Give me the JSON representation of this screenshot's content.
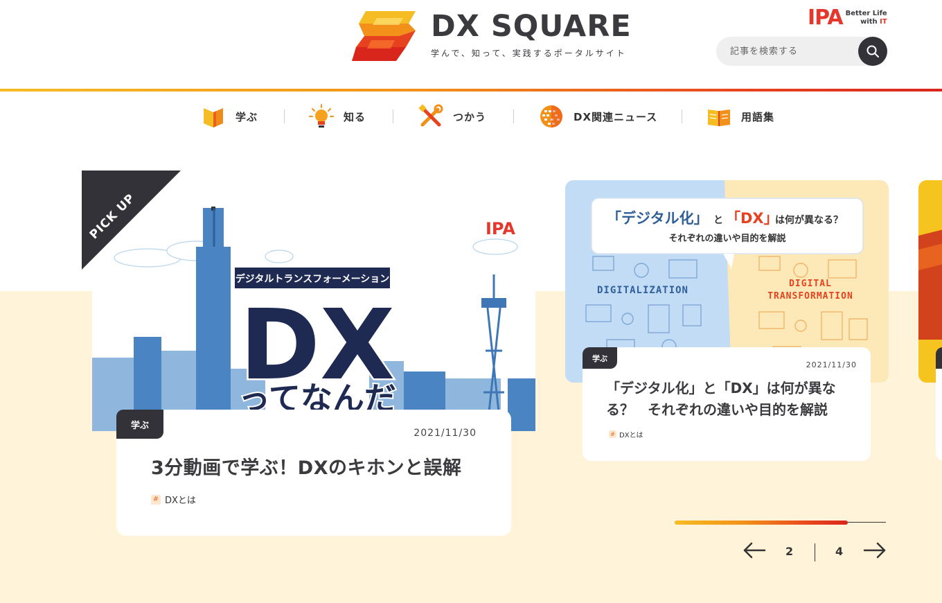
{
  "header": {
    "logo_title": "DX SQUARE",
    "logo_tagline": "学んで、知って、実践するポータルサイト",
    "ipa_letters": "IPA",
    "ipa_slogan_line1": "Better Life",
    "ipa_slogan_with": "with",
    "ipa_slogan_it": "IT",
    "search_placeholder": "記事を検索する"
  },
  "nav": [
    {
      "label": "学ぶ",
      "icon": "book-icon"
    },
    {
      "label": "知る",
      "icon": "lightbulb-icon"
    },
    {
      "label": "つかう",
      "icon": "tools-icon"
    },
    {
      "label": "DX関連ニュース",
      "icon": "globe-icon"
    },
    {
      "label": "用語集",
      "icon": "open-book-icon"
    }
  ],
  "pickup_label": "PICK UP",
  "featured": {
    "category": "学ぶ",
    "date": "2021/11/30",
    "title": "3分動画で学ぶ！DXのキホンと誤解",
    "hashtag": "DXとは",
    "image": {
      "banner": "デジタルトランスフォーメーション",
      "big": "DX",
      "sub": "ってなんだ",
      "brand": "IPA"
    }
  },
  "card2": {
    "category": "学ぶ",
    "date": "2021/11/30",
    "title": "「デジタル化」と「DX」は何が異なる？　それぞれの違いや目的を解説",
    "hashtag": "DXとは",
    "image": {
      "bubble_q1": "「デジタル化」",
      "bubble_to": "と",
      "bubble_q2": "「DX」",
      "bubble_tail": "は何が異なる？",
      "bubble_line2": "それぞれの違いや目的を解説",
      "left_label": "DIGITALIZATION",
      "right_label_1": "DIGITAL",
      "right_label_2": "TRANSFORMATION"
    }
  },
  "pager": {
    "current": "2",
    "total": "4",
    "progress": 0.82
  },
  "colors": {
    "accent_orange": "#f29019",
    "accent_red": "#e5372b",
    "dark": "#333238",
    "cream": "#fff3d9"
  }
}
